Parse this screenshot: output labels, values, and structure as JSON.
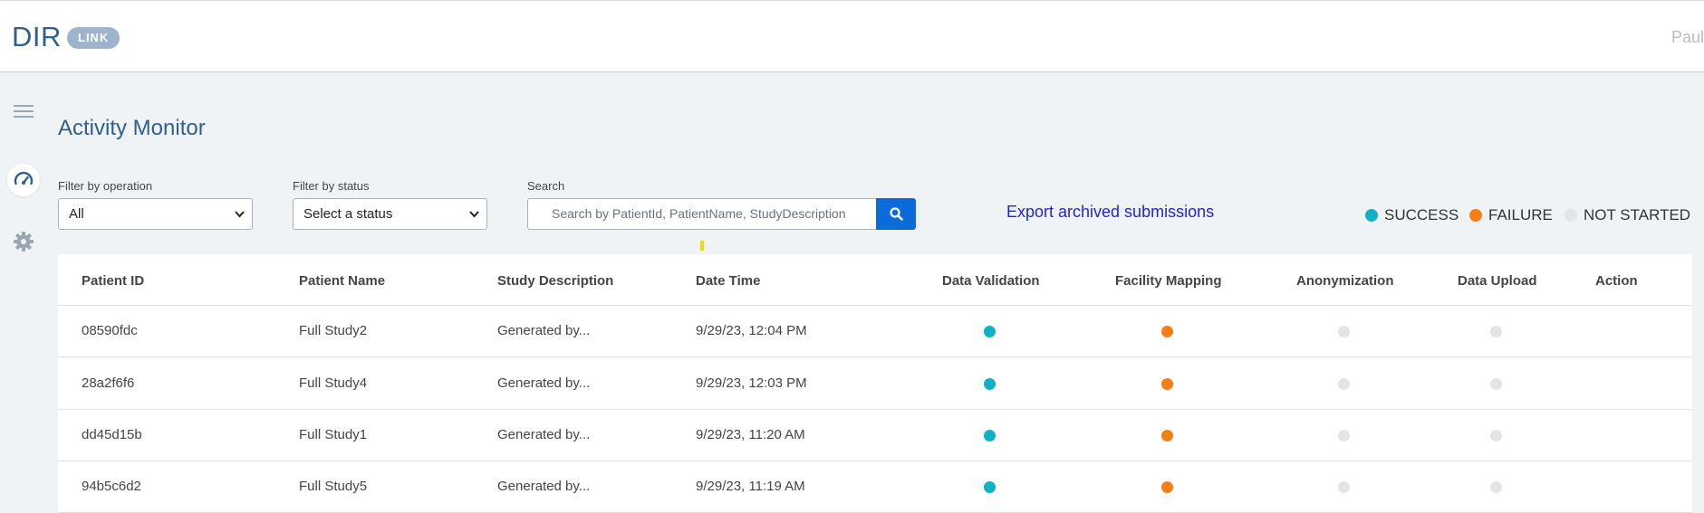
{
  "header": {
    "brand": "DIR",
    "badge": "LINK",
    "user": "Paul"
  },
  "sidebar": {
    "items": [
      {
        "icon": "menu-icon"
      },
      {
        "icon": "dashboard-gauge-icon",
        "active": true
      },
      {
        "icon": "gear-icon"
      }
    ]
  },
  "page": {
    "title": "Activity Monitor"
  },
  "filters": {
    "operation_label": "Filter by operation",
    "operation_value": "All",
    "status_label": "Filter by status",
    "status_value": "Select a status",
    "search_label": "Search",
    "search_placeholder": "Search by PatientId, PatientName, StudyDescription"
  },
  "export_link": "Export archived submissions",
  "legend": {
    "success": "SUCCESS",
    "failure": "FAILURE",
    "not_started": "NOT STARTED"
  },
  "colors": {
    "success": "#0fb2c4",
    "failure": "#f57f17",
    "not_started": "#e2e4e6",
    "primary": "#0b6bd9",
    "title": "#2f5f8a"
  },
  "table": {
    "headers": {
      "patient_id": "Patient ID",
      "patient_name": "Patient Name",
      "study_description": "Study Description",
      "date_time": "Date Time",
      "data_validation": "Data Validation",
      "facility_mapping": "Facility Mapping",
      "anonymization": "Anonymization",
      "data_upload": "Data Upload",
      "action": "Action"
    },
    "rows": [
      {
        "patient_id": "08590fdc",
        "patient_name": "Full Study2",
        "study_description": "Generated by...",
        "date_time": "9/29/23, 12:04 PM",
        "data_validation": "success",
        "facility_mapping": "failure",
        "anonymization": "not_started",
        "data_upload": "not_started"
      },
      {
        "patient_id": "28a2f6f6",
        "patient_name": "Full Study4",
        "study_description": "Generated by...",
        "date_time": "9/29/23, 12:03 PM",
        "data_validation": "success",
        "facility_mapping": "failure",
        "anonymization": "not_started",
        "data_upload": "not_started"
      },
      {
        "patient_id": "dd45d15b",
        "patient_name": "Full Study1",
        "study_description": "Generated by...",
        "date_time": "9/29/23, 11:20 AM",
        "data_validation": "success",
        "facility_mapping": "failure",
        "anonymization": "not_started",
        "data_upload": "not_started"
      },
      {
        "patient_id": "94b5c6d2",
        "patient_name": "Full Study5",
        "study_description": "Generated by...",
        "date_time": "9/29/23, 11:19 AM",
        "data_validation": "success",
        "facility_mapping": "failure",
        "anonymization": "not_started",
        "data_upload": "not_started"
      }
    ]
  }
}
